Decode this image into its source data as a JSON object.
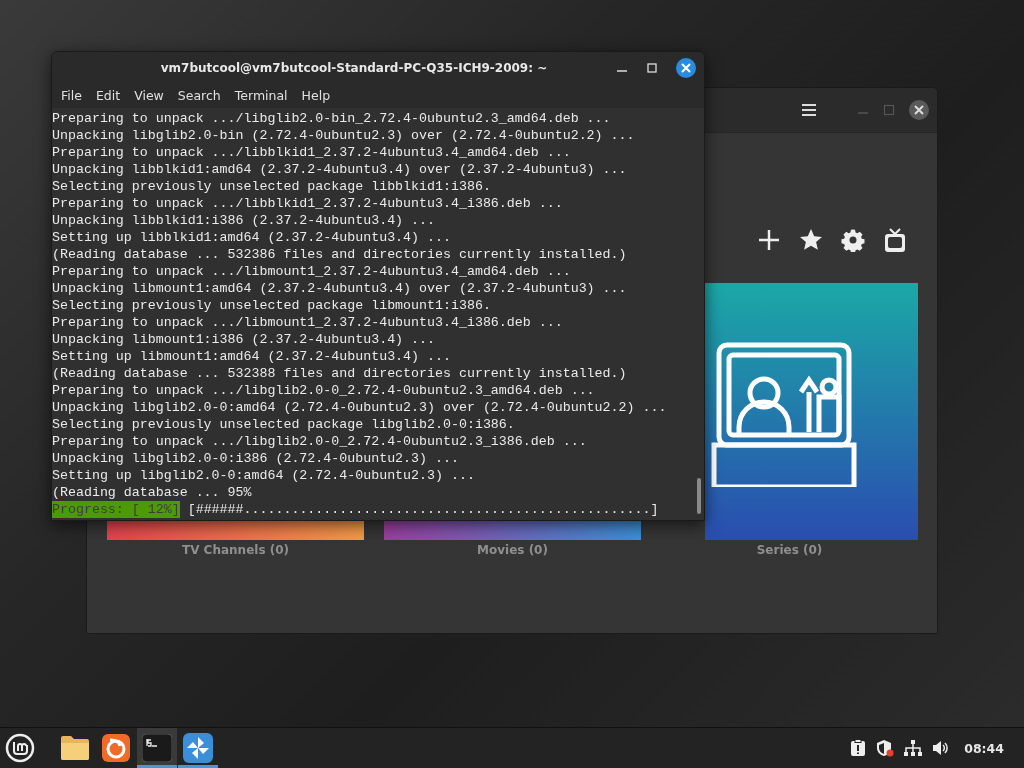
{
  "app_window": {
    "cards": [
      {
        "kind": "channels",
        "label": "TV Channels (0)"
      },
      {
        "kind": "movies",
        "label": "Movies (0)"
      },
      {
        "kind": "series",
        "label": "Series (0)"
      }
    ]
  },
  "terminal": {
    "title": "vm7butcool@vm7butcool-Standard-PC-Q35-ICH9-2009: ~",
    "menu": [
      "File",
      "Edit",
      "View",
      "Search",
      "Terminal",
      "Help"
    ],
    "lines": [
      "Preparing to unpack .../libglib2.0-bin_2.72.4-0ubuntu2.3_amd64.deb ...",
      "Unpacking libglib2.0-bin (2.72.4-0ubuntu2.3) over (2.72.4-0ubuntu2.2) ...",
      "Preparing to unpack .../libblkid1_2.37.2-4ubuntu3.4_amd64.deb ...",
      "Unpacking libblkid1:amd64 (2.37.2-4ubuntu3.4) over (2.37.2-4ubuntu3) ...",
      "Selecting previously unselected package libblkid1:i386.",
      "Preparing to unpack .../libblkid1_2.37.2-4ubuntu3.4_i386.deb ...",
      "Unpacking libblkid1:i386 (2.37.2-4ubuntu3.4) ...",
      "Setting up libblkid1:amd64 (2.37.2-4ubuntu3.4) ...",
      "(Reading database ... 532386 files and directories currently installed.)",
      "Preparing to unpack .../libmount1_2.37.2-4ubuntu3.4_amd64.deb ...",
      "Unpacking libmount1:amd64 (2.37.2-4ubuntu3.4) over (2.37.2-4ubuntu3) ...",
      "Selecting previously unselected package libmount1:i386.",
      "Preparing to unpack .../libmount1_2.37.2-4ubuntu3.4_i386.deb ...",
      "Unpacking libmount1:i386 (2.37.2-4ubuntu3.4) ...",
      "Setting up libmount1:amd64 (2.37.2-4ubuntu3.4) ...",
      "(Reading database ... 532388 files and directories currently installed.)",
      "Preparing to unpack .../libglib2.0-0_2.72.4-0ubuntu2.3_amd64.deb ...",
      "Unpacking libglib2.0-0:amd64 (2.72.4-0ubuntu2.3) over (2.72.4-0ubuntu2.2) ...",
      "Selecting previously unselected package libglib2.0-0:i386.",
      "Preparing to unpack .../libglib2.0-0_2.72.4-0ubuntu2.3_i386.deb ...",
      "Unpacking libglib2.0-0:i386 (2.72.4-0ubuntu2.3) ...",
      "Setting up libglib2.0-0:amd64 (2.72.4-0ubuntu2.3) ...",
      "(Reading database ... 95%"
    ],
    "progress_label": "Progress: [ 12%]",
    "progress_bar": "[######...................................................]"
  },
  "taskbar": {
    "apps": [
      {
        "kind": "files",
        "running": false,
        "selected": false
      },
      {
        "kind": "browser",
        "running": false,
        "selected": false
      },
      {
        "kind": "terminal",
        "running": true,
        "selected": true
      },
      {
        "kind": "media",
        "running": true,
        "selected": false
      }
    ],
    "clock": "08:44"
  }
}
